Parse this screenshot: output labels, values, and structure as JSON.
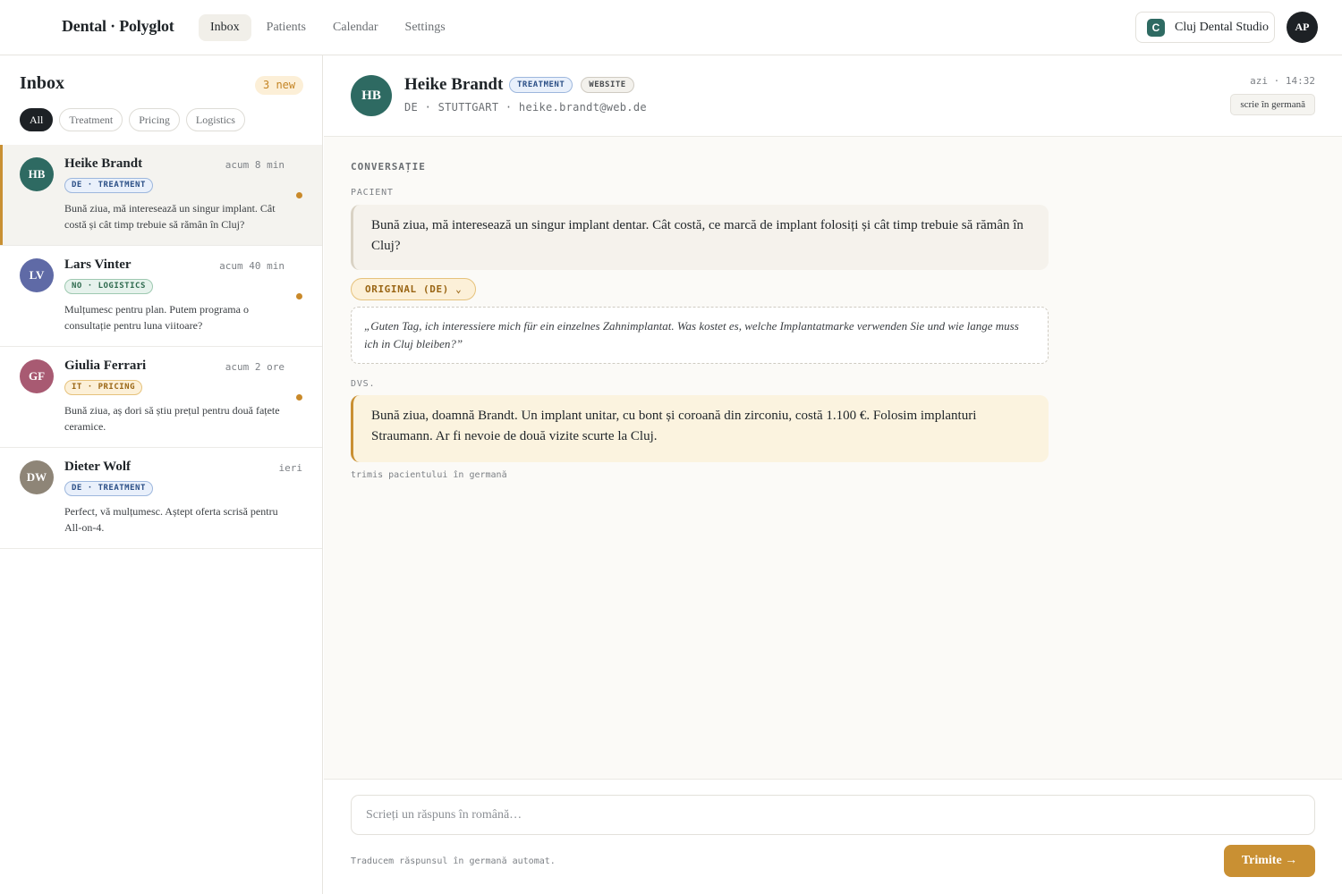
{
  "topbar": {
    "brand": "Dental · Polyglot",
    "nav": [
      {
        "label": "Inbox",
        "active": true
      },
      {
        "label": "Patients"
      },
      {
        "label": "Calendar"
      },
      {
        "label": "Settings"
      }
    ],
    "clinic": {
      "badge": "C",
      "name": "Cluj Dental Studio"
    },
    "user_initials": "AP"
  },
  "sidebar": {
    "title": "Inbox",
    "new_count": "3 new",
    "filters": [
      {
        "label": "All",
        "active": true
      },
      {
        "label": "Treatment"
      },
      {
        "label": "Pricing"
      },
      {
        "label": "Logistics"
      }
    ],
    "conversations": [
      {
        "initials": "HB",
        "name": "Heike Brandt",
        "time": "acum 8 min",
        "tag": "DE · TREATMENT",
        "tag_style": "blue",
        "preview": "Bună ziua, mă interesează un singur implant. Cât costă și cât timp trebuie să rămân în Cluj?",
        "unread": true,
        "avatar_color": "#2e6a62",
        "selected": true
      },
      {
        "initials": "LV",
        "name": "Lars Vinter",
        "time": "acum 40 min",
        "tag": "NO · LOGISTICS",
        "tag_style": "green",
        "preview": "Mulțumesc pentru plan. Putem programa o consultație pentru luna viitoare?",
        "unread": true,
        "avatar_color": "#5f6aa6"
      },
      {
        "initials": "GF",
        "name": "Giulia Ferrari",
        "time": "acum 2 ore",
        "tag": "IT · PRICING",
        "tag_style": "amber",
        "preview": "Bună ziua, aș dori să știu prețul pentru două fațete ceramice.",
        "unread": true,
        "avatar_color": "#a85a72"
      },
      {
        "initials": "DW",
        "name": "Dieter Wolf",
        "time": "ieri",
        "tag": "DE · TREATMENT",
        "tag_style": "blue",
        "preview": "Perfect, vă mulțumesc. Aștept oferta scrisă pentru All-on-4.",
        "unread": false,
        "avatar_color": "#8e8577"
      }
    ]
  },
  "conversation": {
    "patient": {
      "initials": "HB",
      "name": "Heike Brandt",
      "tags": [
        "TREATMENT",
        "WEBSITE"
      ],
      "meta": "DE · STUTTGART · heike.brandt@web.de"
    },
    "time": "azi · 14:32",
    "language_pill": "scrie în germană",
    "section_label": "CONVERSAȚIE",
    "patient_label": "PACIENT",
    "patient_message": "Bună ziua, mă interesează un singur implant dentar. Cât costă, ce marcă de implant folosiți și cât timp trebuie să rămân în Cluj?",
    "original_toggle": "ORIGINAL (DE) ⌄",
    "original_text": "„Guten Tag, ich interessiere mich für ein einzelnes Zahnimplantat. Was kostet es, welche Implantatmarke verwenden Sie und wie lange muss ich in Cluj bleiben?”",
    "you_label": "DVS.",
    "your_message": "Bună ziua, doamnă Brandt. Un implant unitar, cu bont și coroană din zirconiu, costă 1.100 €. Folosim implanturi Straumann. Ar fi nevoie de două vizite scurte la Cluj.",
    "sent_note": "trimis pacientului în germană"
  },
  "composer": {
    "placeholder": "Scrieți un răspuns în română…",
    "note": "Traducem răspunsul în germană automat.",
    "send_label": "Trimite →"
  },
  "colors": {
    "accent": "#c99033",
    "brand_green": "#2e6a62",
    "dark": "#1d2125"
  }
}
